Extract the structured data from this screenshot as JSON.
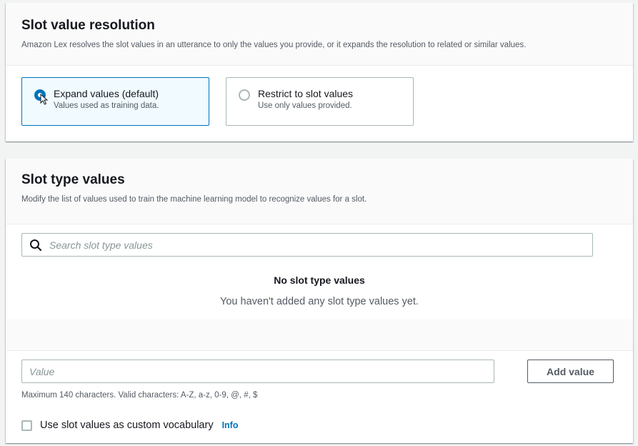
{
  "colors": {
    "accent": "#0073bb",
    "selected_tile_bg": "#f1faff",
    "page_bg": "#f2f3f3",
    "secondary_text": "#545b64"
  },
  "slot_value_resolution": {
    "title": "Slot value resolution",
    "description": "Amazon Lex resolves the slot values in an utterance to only the values you provide, or it expands the resolution to related or similar values.",
    "options": [
      {
        "label": "Expand values (default)",
        "description": "Values used as training data.",
        "selected": true
      },
      {
        "label": "Restrict to slot values",
        "description": "Use only values provided.",
        "selected": false
      }
    ]
  },
  "slot_type_values": {
    "title": "Slot type values",
    "description": "Modify the list of values used to train the machine learning model to recognize values for a slot.",
    "search": {
      "placeholder": "Search slot type values",
      "value": "",
      "icon": "search-icon"
    },
    "empty_state": {
      "title": "No slot type values",
      "message": "You haven't added any slot type values yet."
    },
    "value_input": {
      "placeholder": "Value",
      "value": ""
    },
    "add_button_label": "Add value",
    "constraint_text": "Maximum 140 characters. Valid characters: A-Z, a-z, 0-9, @, #, $",
    "custom_vocabulary": {
      "label": "Use slot values as custom vocabulary",
      "checked": false,
      "info_label": "Info"
    }
  }
}
